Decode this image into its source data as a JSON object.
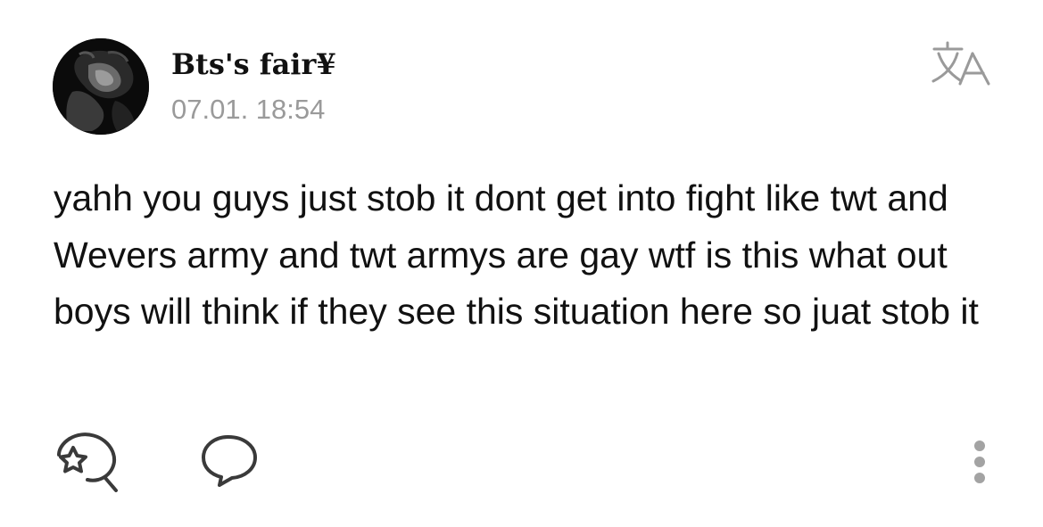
{
  "post": {
    "author": "Bts's fair¥",
    "timestamp": "07.01. 18:54",
    "body": "yahh you guys just stob it dont get into fight like twt and Wevers army and twt armys are gay wtf is this what out boys will think if they see this situation here so juat stob it"
  },
  "icons": {
    "translate": "translate-icon",
    "react": "star-reaction-icon",
    "comment": "speech-bubble-icon",
    "more": "more-vertical-icon"
  },
  "colors": {
    "text": "#111111",
    "muted": "#9a9a9a",
    "icon": "#3a3a3a",
    "more_dots": "#a3a3a3"
  }
}
